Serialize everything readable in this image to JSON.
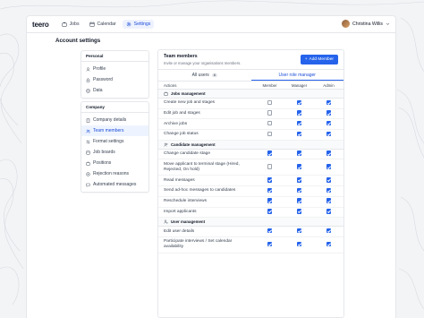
{
  "app": {
    "logo": "teero",
    "nav": [
      {
        "label": "Jobs",
        "icon": "briefcase-icon",
        "active": false
      },
      {
        "label": "Calendar",
        "icon": "calendar-icon",
        "active": false
      },
      {
        "label": "Settings",
        "icon": "gear-icon",
        "active": true
      }
    ],
    "user": {
      "name": "Christina Willis"
    }
  },
  "page": {
    "title": "Account settings"
  },
  "sidebar": {
    "personal": {
      "heading": "Personal",
      "items": [
        {
          "label": "Profile",
          "icon": "user-icon"
        },
        {
          "label": "Password",
          "icon": "lock-icon"
        },
        {
          "label": "Data",
          "icon": "database-icon"
        }
      ]
    },
    "company": {
      "heading": "Company",
      "items": [
        {
          "label": "Company details",
          "icon": "building-icon",
          "active": false
        },
        {
          "label": "Team members",
          "icon": "users-icon",
          "active": true
        },
        {
          "label": "Format settings",
          "icon": "sliders-icon",
          "active": false
        },
        {
          "label": "Job boards",
          "icon": "board-icon",
          "active": false
        },
        {
          "label": "Positions",
          "icon": "briefcase-icon",
          "active": false
        },
        {
          "label": "Rejection reasons",
          "icon": "x-circle-icon",
          "active": false
        },
        {
          "label": "Automated messages",
          "icon": "message-icon",
          "active": false
        }
      ]
    }
  },
  "team": {
    "title": "Team members",
    "subtitle": "Invite or manage your organisations members.",
    "add_label": "Add Member",
    "tabs": [
      {
        "label": "All users",
        "count": "8",
        "active": false
      },
      {
        "label": "User role manager",
        "count": "",
        "active": true
      }
    ],
    "columns": {
      "actions": "Actions",
      "member": "Member",
      "manager": "Manager",
      "admin": "Admin"
    }
  },
  "permissions": [
    {
      "type": "section",
      "label": "Jobs management",
      "icon": "briefcase-icon"
    },
    {
      "type": "row",
      "label": "Create new job and stages",
      "member": false,
      "manager": true,
      "admin": true
    },
    {
      "type": "row",
      "label": "Edit job and stages",
      "member": false,
      "manager": true,
      "admin": true
    },
    {
      "type": "row",
      "label": "Archive jobs",
      "member": false,
      "manager": true,
      "admin": true
    },
    {
      "type": "row",
      "label": "Change job status",
      "member": false,
      "manager": true,
      "admin": true
    },
    {
      "type": "section",
      "label": "Candidate management",
      "icon": "users-icon"
    },
    {
      "type": "row",
      "label": "Change candidate stage",
      "member": true,
      "manager": true,
      "admin": true
    },
    {
      "type": "row",
      "label": "Move applicant to terminal stage (Hired, Rejected, On hold)",
      "member": false,
      "manager": true,
      "admin": true
    },
    {
      "type": "row",
      "label": "Read messages",
      "member": true,
      "manager": true,
      "admin": true
    },
    {
      "type": "row",
      "label": "Send ad-hoc messages to candidates",
      "member": true,
      "manager": true,
      "admin": true
    },
    {
      "type": "row",
      "label": "Reschedule interviews",
      "member": true,
      "manager": true,
      "admin": true
    },
    {
      "type": "row",
      "label": "Import applicants",
      "member": true,
      "manager": true,
      "admin": true
    },
    {
      "type": "section",
      "label": "User management",
      "icon": "user-gear-icon"
    },
    {
      "type": "row",
      "label": "Edit user details",
      "member": true,
      "manager": true,
      "admin": true
    },
    {
      "type": "row",
      "label": "Participate interviews / Set calendar availability",
      "member": true,
      "manager": true,
      "admin": true
    }
  ],
  "colors": {
    "accent": "#2563eb",
    "background": "#f3f4f6",
    "border": "#e5e7eb"
  }
}
